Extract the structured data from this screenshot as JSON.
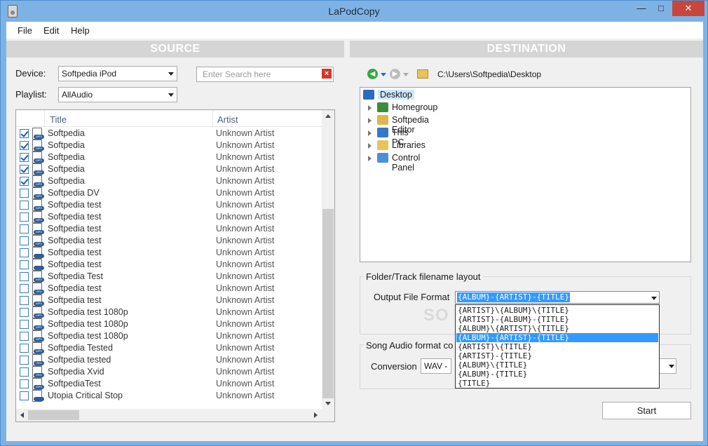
{
  "window": {
    "title": "LaPodCopy",
    "min_glyph": "—",
    "max_glyph": "□",
    "close_glyph": "✕"
  },
  "menu": {
    "file": "File",
    "edit": "Edit",
    "help": "Help"
  },
  "source": {
    "header": "SOURCE",
    "device_label": "Device:",
    "device_value": "Softpedia iPod",
    "playlist_label": "Playlist:",
    "playlist_value": "AllAudio",
    "search_placeholder": "Enter Search here",
    "columns": {
      "title": "Title",
      "artist": "Artist"
    },
    "tracks": [
      {
        "title": "Softpedia",
        "artist": "Unknown Artist",
        "checked": true,
        "tag": "MP3"
      },
      {
        "title": "Softpedia",
        "artist": "Unknown Artist",
        "checked": true,
        "tag": "MP3"
      },
      {
        "title": "Softpedia",
        "artist": "Unknown Artist",
        "checked": true,
        "tag": "MP3"
      },
      {
        "title": "Softpedia",
        "artist": "Unknown Artist",
        "checked": true,
        "tag": "VRU"
      },
      {
        "title": "Softpedia",
        "artist": "Unknown Artist",
        "checked": true,
        "tag": "MP3"
      },
      {
        "title": "Softpedia DV",
        "artist": "Unknown Artist",
        "checked": false,
        "tag": "MP3"
      },
      {
        "title": "Softpedia test",
        "artist": "Unknown Artist",
        "checked": false,
        "tag": "MP3"
      },
      {
        "title": "Softpedia test",
        "artist": "Unknown Artist",
        "checked": false,
        "tag": "MP3"
      },
      {
        "title": "Softpedia test",
        "artist": "Unknown Artist",
        "checked": false,
        "tag": "MP3"
      },
      {
        "title": "Softpedia test",
        "artist": "Unknown Artist",
        "checked": false,
        "tag": "MP3"
      },
      {
        "title": "Softpedia test",
        "artist": "Unknown Artist",
        "checked": false,
        "tag": ""
      },
      {
        "title": "Softpedia test",
        "artist": "Unknown Artist",
        "checked": false,
        "tag": ""
      },
      {
        "title": "Softpedia Test",
        "artist": "Unknown Artist",
        "checked": false,
        "tag": "MP3"
      },
      {
        "title": "Softpedia test",
        "artist": "Unknown Artist",
        "checked": false,
        "tag": "VRU"
      },
      {
        "title": "Softpedia test",
        "artist": "Unknown Artist",
        "checked": false,
        "tag": "MP3"
      },
      {
        "title": "Softpedia test 1080p",
        "artist": "Unknown Artist",
        "checked": false,
        "tag": "MP3"
      },
      {
        "title": "Softpedia test 1080p",
        "artist": "Unknown Artist",
        "checked": false,
        "tag": "MP3"
      },
      {
        "title": "Softpedia test 1080p",
        "artist": "Unknown Artist",
        "checked": false,
        "tag": "MP3"
      },
      {
        "title": "Softpedia Tested",
        "artist": "Unknown Artist",
        "checked": false,
        "tag": "MP3"
      },
      {
        "title": "Softpedia tested",
        "artist": "Unknown Artist",
        "checked": false,
        "tag": "VRU"
      },
      {
        "title": "Softpedia Xvid",
        "artist": "Unknown Artist",
        "checked": false,
        "tag": "VRU"
      },
      {
        "title": "SoftpediaTest",
        "artist": "Unknown Artist",
        "checked": false,
        "tag": "MP3"
      },
      {
        "title": "Utopia Critical Stop",
        "artist": "Unknown Artist",
        "checked": false,
        "tag": ""
      }
    ]
  },
  "destination": {
    "header": "DESTINATION",
    "path": "C:\\Users\\Softpedia\\Desktop",
    "tree": [
      {
        "label": "Desktop",
        "root": true,
        "icon_color": "#2a6bbf"
      },
      {
        "label": "Homegroup",
        "icon_color": "#3b8d3b"
      },
      {
        "label": "Softpedia Editor",
        "icon_color": "#e0b64d"
      },
      {
        "label": "This PC",
        "icon_color": "#3478c6"
      },
      {
        "label": "Libraries",
        "icon_color": "#e7c55a"
      },
      {
        "label": "Control Panel",
        "icon_color": "#4a8fd8"
      }
    ],
    "folder_group_title": "Folder/Track filename layout",
    "output_label": "Output File Format",
    "output_value": "{ALBUM}-{ARTIST}-{TITLE}",
    "format_options": [
      "{ARTIST}\\{ALBUM}\\{TITLE}",
      "{ARTIST}-{ALBUM}-{TITLE}",
      "{ALBUM}\\{ARTIST}\\{TITLE}",
      "{ALBUM}-{ARTIST}-{TITLE}",
      "{ARTIST}\\{TITLE}",
      "{ARTIST}-{TITLE}",
      "{ALBUM}\\{TITLE}",
      "{ALBUM}-{TITLE}",
      "{TITLE}"
    ],
    "selected_option_index": 3,
    "audio_group_title": "Song Audio format co",
    "conversion_label": "Conversion",
    "conversion_value": "WAV - V",
    "start_label": "Start"
  },
  "colors": {
    "accent": "#3399ff",
    "window_frame": "#7fb2e4",
    "close": "#c9463d"
  }
}
